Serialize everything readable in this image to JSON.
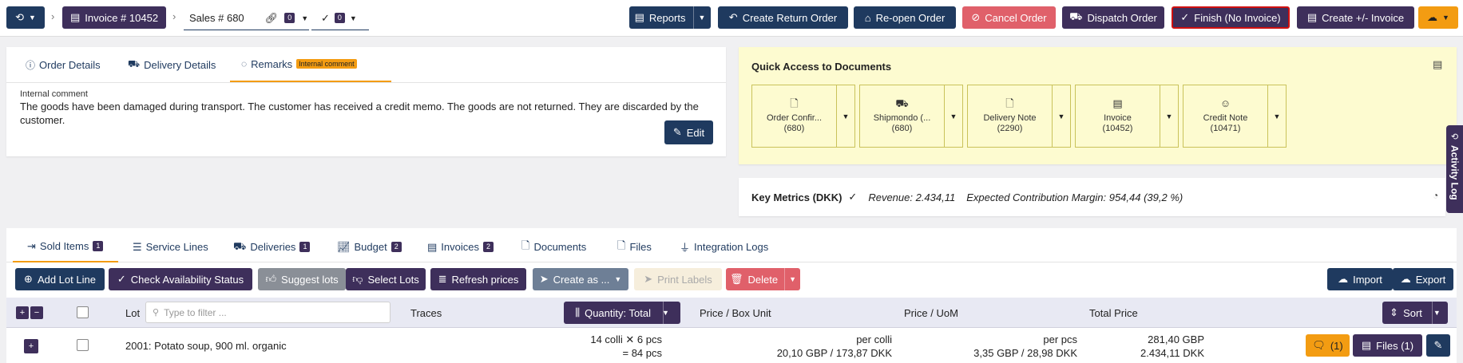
{
  "topbar": {
    "history_icon": "history-icon",
    "breadcrumb_invoice": "Invoice # 10452",
    "breadcrumb_sales": "Sales # 680",
    "link_count": "0",
    "check_count": "0",
    "buttons": {
      "reports": "Reports",
      "create_return": "Create Return Order",
      "reopen": "Re-open Order",
      "cancel": "Cancel Order",
      "dispatch": "Dispatch Order",
      "finish": "Finish (No Invoice)",
      "create_invoice": "Create +/- Invoice"
    }
  },
  "info_tabs": {
    "order_details": "Order Details",
    "delivery_details": "Delivery Details",
    "remarks": "Remarks",
    "remarks_badge": "Internal comment"
  },
  "remark": {
    "label": "Internal comment",
    "text": "The goods have been damaged during transport. The customer has received a credit memo. The goods are not returned. They are discarded by the customer.",
    "edit": "Edit"
  },
  "quick_access": {
    "title": "Quick Access to Documents",
    "docs": [
      {
        "name": "Order Confir...",
        "num": "(680)",
        "icon": "document-icon"
      },
      {
        "name": "Shipmondo (...",
        "num": "(680)",
        "icon": "truck-icon"
      },
      {
        "name": "Delivery Note",
        "num": "(2290)",
        "icon": "document-icon"
      },
      {
        "name": "Invoice",
        "num": "(10452)",
        "icon": "invoice-icon"
      },
      {
        "name": "Credit Note",
        "num": "(10471)",
        "icon": "smile-icon"
      }
    ]
  },
  "metrics": {
    "label": "Key Metrics (DKK)",
    "revenue": "Revenue: 2.434,11",
    "margin": "Expected Contribution Margin: 954,44 (39,2 %)"
  },
  "activity_log": "Activity Log",
  "lower_tabs": [
    {
      "label": "Sold Items",
      "badge": "1"
    },
    {
      "label": "Service Lines",
      "badge": ""
    },
    {
      "label": "Deliveries",
      "badge": "1"
    },
    {
      "label": "Budget",
      "badge": "2"
    },
    {
      "label": "Invoices",
      "badge": "2"
    },
    {
      "label": "Documents",
      "badge": ""
    },
    {
      "label": "Files",
      "badge": ""
    },
    {
      "label": "Integration Logs",
      "badge": ""
    }
  ],
  "toolbar": {
    "add_lot": "Add Lot Line",
    "check_availability": "Check Availability Status",
    "suggest_lots": "Suggest lots",
    "select_lots": "Select Lots",
    "refresh_prices": "Refresh prices",
    "create_as": "Create as ...",
    "print_labels": "Print Labels",
    "delete": "Delete",
    "import": "Import",
    "export": "Export"
  },
  "table": {
    "col_lot": "Lot",
    "filter_placeholder": "Type to filter ...",
    "col_traces": "Traces",
    "quantity_button": "Quantity: Total",
    "col_price_box": "Price / Box Unit",
    "col_price_uom": "Price / UoM",
    "col_total": "Total Price",
    "sort": "Sort",
    "row": {
      "lot": "2001: Potato soup, 900 ml. organic",
      "qty_line1": "14 colli ✕ 6 pcs",
      "qty_line2": "= 84 pcs",
      "box_line1": "per colli",
      "box_line2": "20,10 GBP / 173,87 DKK",
      "uom_line1": "per pcs",
      "uom_line2": "3,35 GBP / 28,98 DKK",
      "total_line1": "281,40 GBP",
      "total_line2": "2.434,11 DKK",
      "comments": "(1)",
      "files": "Files (1)"
    }
  }
}
